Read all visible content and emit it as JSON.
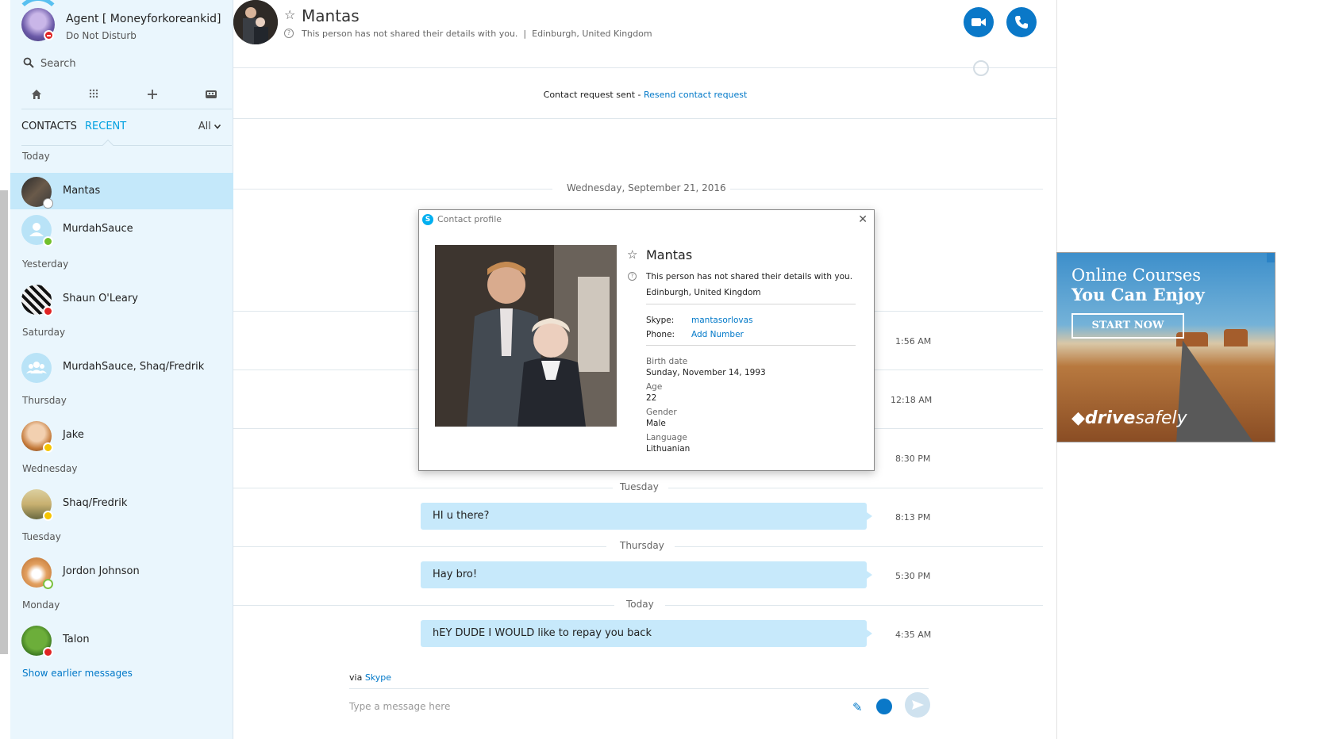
{
  "me": {
    "name": "Agent [ Moneyforkoreankid]",
    "status": "Do Not Disturb"
  },
  "search": {
    "placeholder": "Search"
  },
  "tabs": {
    "contacts": "CONTACTS",
    "recent": "RECENT",
    "filter": "All"
  },
  "groups": {
    "today": "Today",
    "yesterday": "Yesterday",
    "saturday": "Saturday",
    "thursday": "Thursday",
    "wednesday": "Wednesday",
    "tuesday": "Tuesday",
    "monday": "Monday"
  },
  "contacts": [
    {
      "name": "Mantas",
      "status": "unknown",
      "active": true
    },
    {
      "name": "MurdahSauce",
      "status": "online"
    },
    {
      "name": "Shaun O'Leary",
      "status": "do-not-disturb"
    },
    {
      "name": "MurdahSauce, Shaq/Fredrik",
      "status": "group"
    },
    {
      "name": "Jake",
      "status": "away"
    },
    {
      "name": "Shaq/Fredrik",
      "status": "away"
    },
    {
      "name": "Jordon Johnson",
      "status": "offline"
    },
    {
      "name": "Talon",
      "status": "do-not-disturb"
    }
  ],
  "show_earlier": "Show earlier messages",
  "header": {
    "name": "Mantas",
    "note": "This person has not shared their details with you.",
    "separator": "|",
    "location": "Edinburgh, United Kingdom"
  },
  "request": {
    "text": "Contact request sent - ",
    "link": "Resend contact request"
  },
  "chat": {
    "date_top": "Wednesday, September 21, 2016",
    "hidden_times": [
      "1:56 AM",
      "12:18 AM",
      "8:30 PM"
    ],
    "sections": [
      {
        "day": "Tuesday",
        "text": "HI u there?",
        "time": "8:13 PM"
      },
      {
        "day": "Thursday",
        "text": "Hay bro!",
        "time": "5:30 PM"
      },
      {
        "day": "Today",
        "text": "hEY DUDE I WOULD like to repay you back",
        "time": "4:35 AM"
      }
    ]
  },
  "footer": {
    "via": "via ",
    "via_link": "Skype",
    "compose_placeholder": "Type a message here"
  },
  "ad": {
    "line1": "Online Courses",
    "line2": "You Can Enjoy",
    "button": "START NOW",
    "brand_bold": "drive",
    "brand_lite": "safely"
  },
  "dialog": {
    "title": "Contact profile",
    "name": "Mantas",
    "note": "This person has not shared their details with you.",
    "location": "Edinburgh, United Kingdom",
    "skype_label": "Skype:",
    "skype_value": "mantasorlovas",
    "phone_label": "Phone:",
    "phone_value": "Add Number",
    "birth_label": "Birth date",
    "birth_value": "Sunday, November 14, 1993",
    "age_label": "Age",
    "age_value": "22",
    "gender_label": "Gender",
    "gender_value": "Male",
    "language_label": "Language",
    "language_value": "Lithuanian"
  },
  "colors": {
    "accent": "#00a0e0",
    "link": "#0078c8",
    "bubble": "#c7e9fb",
    "sidebar": "#eaf6fd",
    "active_row": "#c4e8fa"
  },
  "icons": [
    "search-icon",
    "home-icon",
    "dialpad-icon",
    "plus-icon",
    "bot-icon",
    "star-icon",
    "info-icon",
    "video-call-icon",
    "phone-icon",
    "globe-icon",
    "attach-icon",
    "emoji-icon",
    "send-icon",
    "close-icon",
    "skype-icon"
  ]
}
